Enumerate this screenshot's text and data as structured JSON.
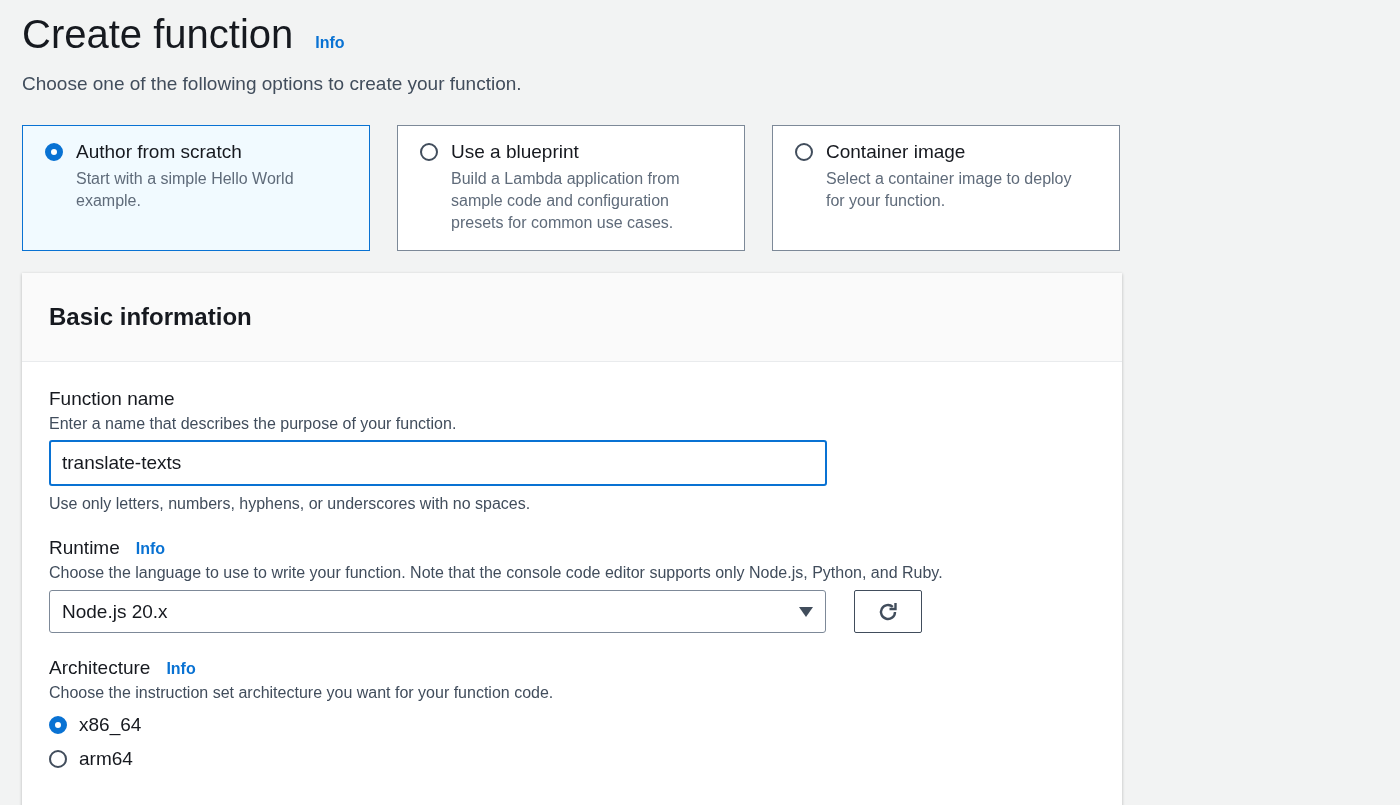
{
  "page": {
    "title": "Create function",
    "info": "Info",
    "subtitle": "Choose one of the following options to create your function."
  },
  "options": [
    {
      "title": "Author from scratch",
      "description": "Start with a simple Hello World example.",
      "selected": true
    },
    {
      "title": "Use a blueprint",
      "description": "Build a Lambda application from sample code and configuration presets for common use cases.",
      "selected": false
    },
    {
      "title": "Container image",
      "description": "Select a container image to deploy for your function.",
      "selected": false
    }
  ],
  "basic_information": {
    "heading": "Basic information",
    "function_name": {
      "label": "Function name",
      "description": "Enter a name that describes the purpose of your function.",
      "value": "translate-texts",
      "hint": "Use only letters, numbers, hyphens, or underscores with no spaces."
    },
    "runtime": {
      "label": "Runtime",
      "info": "Info",
      "description": "Choose the language to use to write your function. Note that the console code editor supports only Node.js, Python, and Ruby.",
      "value": "Node.js 20.x"
    },
    "architecture": {
      "label": "Architecture",
      "info": "Info",
      "description": "Choose the instruction set architecture you want for your function code.",
      "options": [
        {
          "label": "x86_64",
          "selected": true
        },
        {
          "label": "arm64",
          "selected": false
        }
      ]
    }
  }
}
